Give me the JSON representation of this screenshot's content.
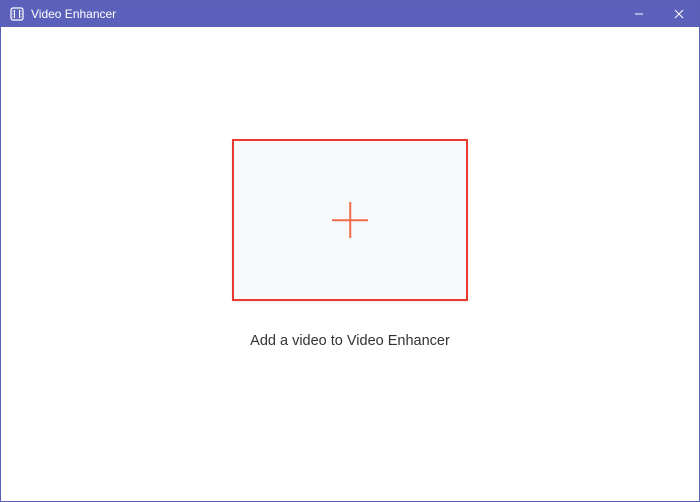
{
  "titlebar": {
    "app_name": "Video Enhancer"
  },
  "main": {
    "instruction": "Add a video to Video Enhancer"
  }
}
